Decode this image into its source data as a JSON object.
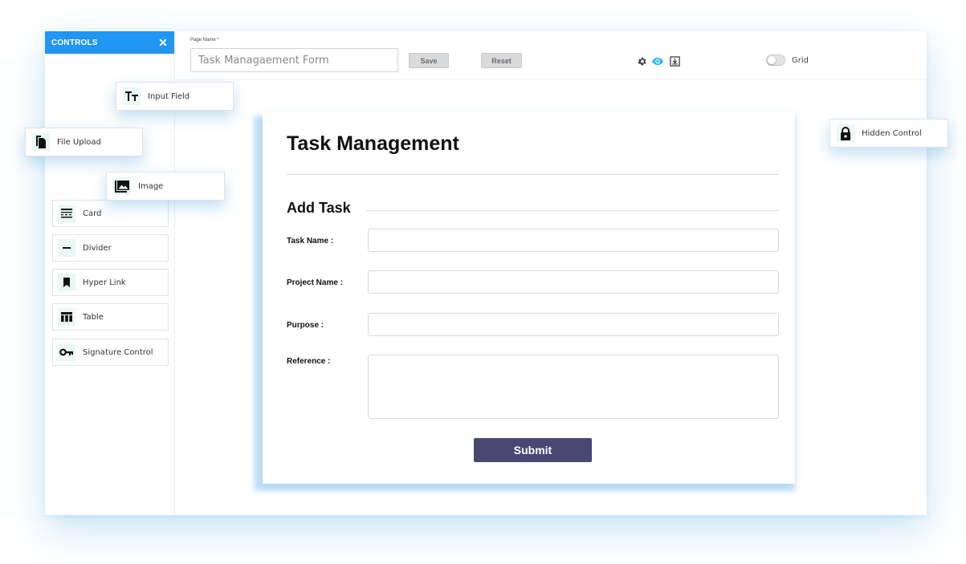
{
  "sidebar": {
    "header_title": "CONTROLS",
    "close_icon": "close-icon",
    "items": [
      {
        "label": "Card",
        "icon": "card-icon"
      },
      {
        "label": "Divider",
        "icon": "divider-icon"
      },
      {
        "label": "Hyper Link",
        "icon": "bookmark-icon"
      },
      {
        "label": "Table",
        "icon": "table-icon"
      },
      {
        "label": "Signature Control",
        "icon": "key-icon"
      }
    ]
  },
  "floating_controls": {
    "input_field": {
      "label": "Input Field",
      "icon": "text-icon"
    },
    "file_upload": {
      "label": "File Upload",
      "icon": "file-icon"
    },
    "image": {
      "label": "Image",
      "icon": "image-icon"
    },
    "hidden_control": {
      "label": "Hidden Control",
      "icon": "lock-icon"
    }
  },
  "toolbar": {
    "page_name_label": "Page Name *",
    "page_name_value": "Task Managaement Form",
    "save_label": "Save",
    "reset_label": "Reset",
    "icons": [
      "gear-icon",
      "eye-icon",
      "download-icon"
    ],
    "grid_label": "Grid",
    "grid_enabled": false
  },
  "form": {
    "title": "Task Management",
    "section_title": "Add Task",
    "fields": [
      {
        "label": "Task Name :",
        "value": ""
      },
      {
        "label": "Project Name :",
        "value": ""
      },
      {
        "label": "Purpose :",
        "value": ""
      },
      {
        "label": "Reference :",
        "value": ""
      }
    ],
    "submit_label": "Submit"
  },
  "colors": {
    "accent": "#2196f3",
    "submit": "#484873",
    "eye_icon": "#29b6f6"
  }
}
